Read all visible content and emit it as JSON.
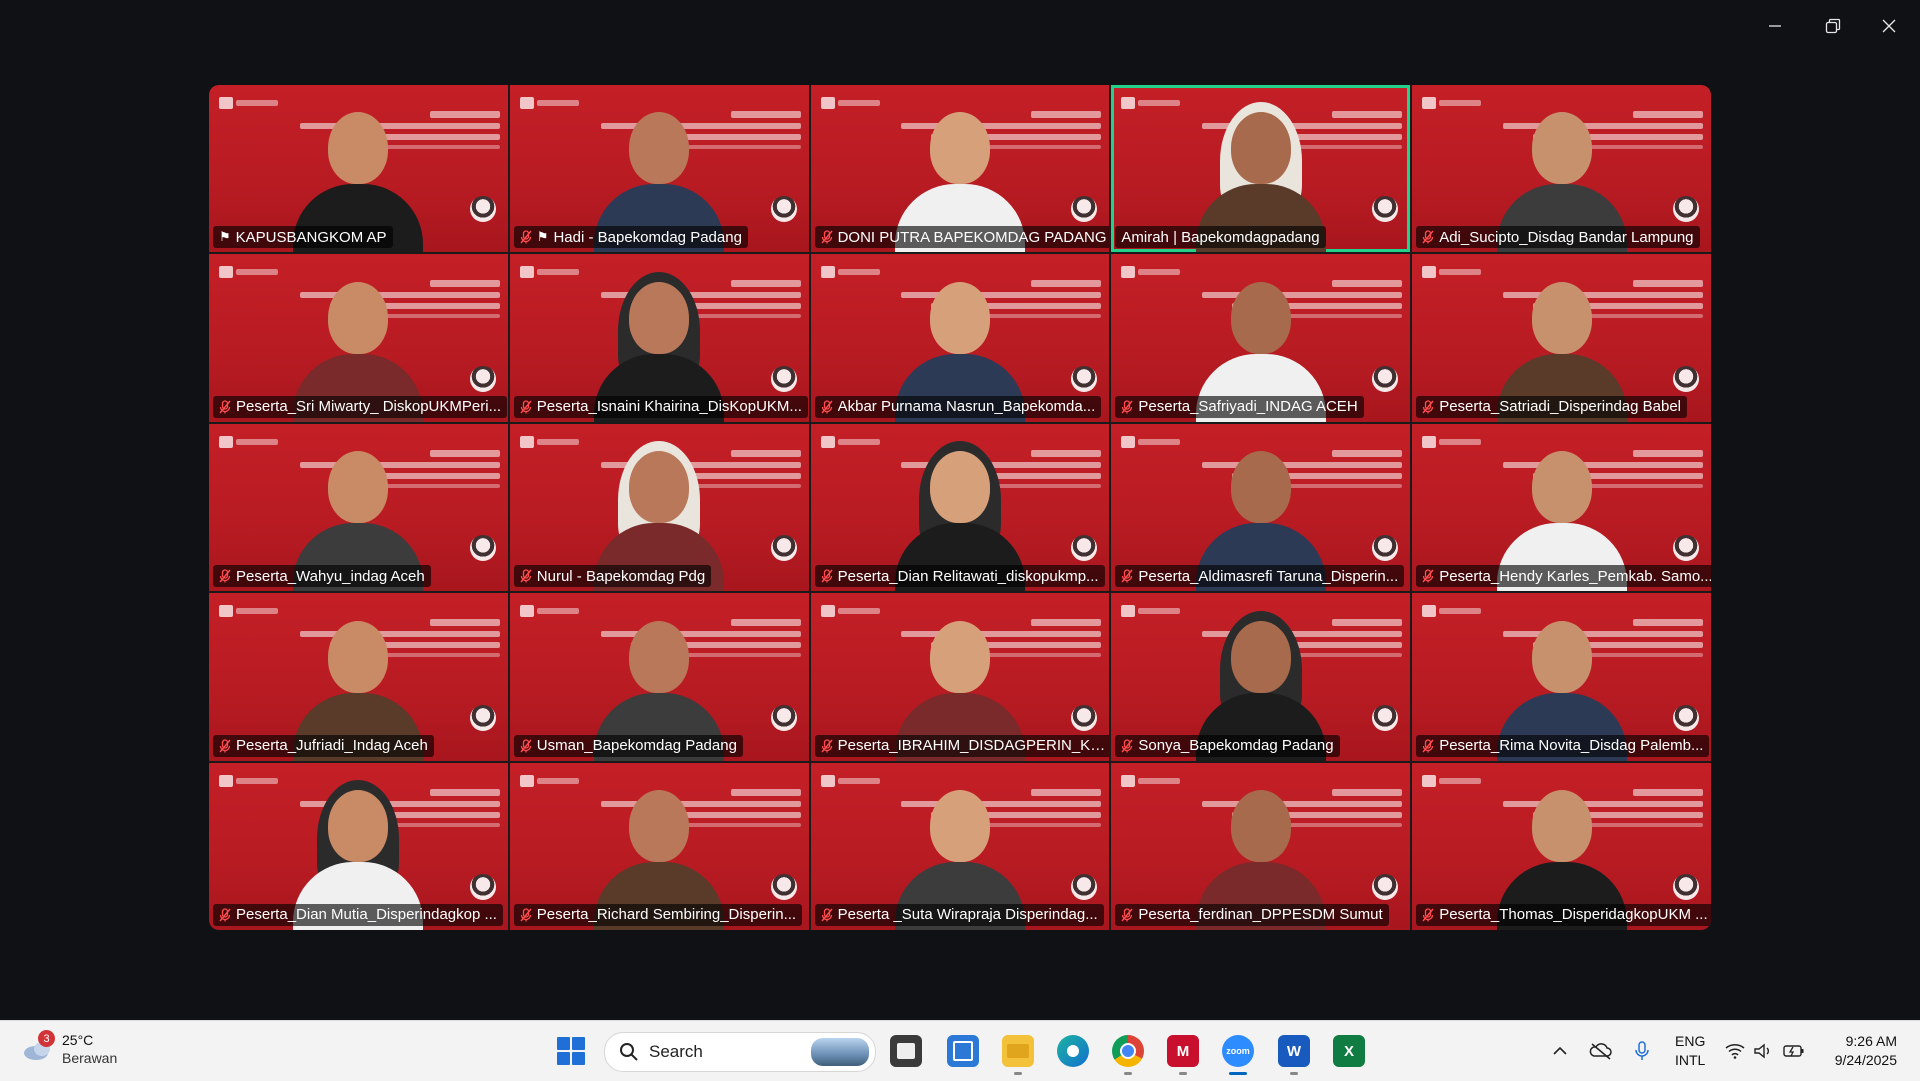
{
  "window": {
    "minimize_icon": "minimize-icon",
    "restore_icon": "restore-icon",
    "close_icon": "close-icon"
  },
  "accent": {
    "active_speaker_border": "#23d18b",
    "tile_background": "#c41f27"
  },
  "participants": [
    {
      "name": "KAPUSBANGKOM AP",
      "muted": false,
      "pinned": true
    },
    {
      "name": "Hadi - Bapekomdag Padang",
      "muted": true,
      "pinned": true
    },
    {
      "name": "DONI PUTRA BAPEKOMDAG PADANG",
      "muted": true,
      "pinned": false
    },
    {
      "name": "Amirah | Bapekomdagpadang",
      "muted": false,
      "pinned": false,
      "active": true
    },
    {
      "name": "Adi_Sucipto_Disdag Bandar Lampung",
      "muted": true,
      "pinned": false
    },
    {
      "name": "Peserta_Sri Miwarty_ DiskopUKMPeri...",
      "muted": true,
      "pinned": false
    },
    {
      "name": "Peserta_Isnaini Khairina_DisKopUKM...",
      "muted": true,
      "pinned": false
    },
    {
      "name": "Akbar Purnama Nasrun_Bapekomda...",
      "muted": true,
      "pinned": false
    },
    {
      "name": "Peserta_Safriyadi_INDAG ACEH",
      "muted": true,
      "pinned": false
    },
    {
      "name": "Peserta_Satriadi_Disperindag Babel",
      "muted": true,
      "pinned": false
    },
    {
      "name": "Peserta_Wahyu_indag Aceh",
      "muted": true,
      "pinned": false
    },
    {
      "name": "Nurul - Bapekomdag Pdg",
      "muted": true,
      "pinned": false
    },
    {
      "name": "Peserta_Dian Relitawati_diskopukmp...",
      "muted": true,
      "pinned": false
    },
    {
      "name": "Peserta_Aldimasrefi Taruna_Disperin...",
      "muted": true,
      "pinned": false
    },
    {
      "name": "Peserta_Hendy Karles_Pemkab. Samo...",
      "muted": true,
      "pinned": false
    },
    {
      "name": "Peserta_Jufriadi_Indag Aceh",
      "muted": true,
      "pinned": false
    },
    {
      "name": "Usman_Bapekomdag Padang",
      "muted": true,
      "pinned": false
    },
    {
      "name": "Peserta_IBRAHIM_DISDAGPERIN_KA...",
      "muted": true,
      "pinned": false
    },
    {
      "name": "Sonya_Bapekomdag Padang",
      "muted": true,
      "pinned": false
    },
    {
      "name": "Peserta_Rima Novita_Disdag Palemb...",
      "muted": true,
      "pinned": false
    },
    {
      "name": "Peserta_Dian Mutia_Disperindagkop ...",
      "muted": true,
      "pinned": false
    },
    {
      "name": "Peserta_Richard Sembiring_Disperin...",
      "muted": true,
      "pinned": false
    },
    {
      "name": "Peserta _Suta Wirapraja Disperindag...",
      "muted": true,
      "pinned": false
    },
    {
      "name": "Peserta_ferdinan_DPPESDM Sumut",
      "muted": true,
      "pinned": false
    },
    {
      "name": "Peserta_Thomas_DisperidagkopUKM ...",
      "muted": true,
      "pinned": false
    }
  ],
  "taskbar": {
    "weather": {
      "badge": "3",
      "temperature": "25°C",
      "condition": "Berawan"
    },
    "search_label": "Search",
    "apps": [
      "file-manager-icon",
      "store-icon",
      "folder-icon",
      "edge-icon",
      "chrome-icon",
      "mcafee-icon",
      "zoom-icon",
      "word-icon",
      "excel-icon"
    ],
    "language": {
      "line1": "ENG",
      "line2": "INTL"
    },
    "clock": {
      "time": "9:26 AM",
      "date": "9/24/2025"
    }
  }
}
